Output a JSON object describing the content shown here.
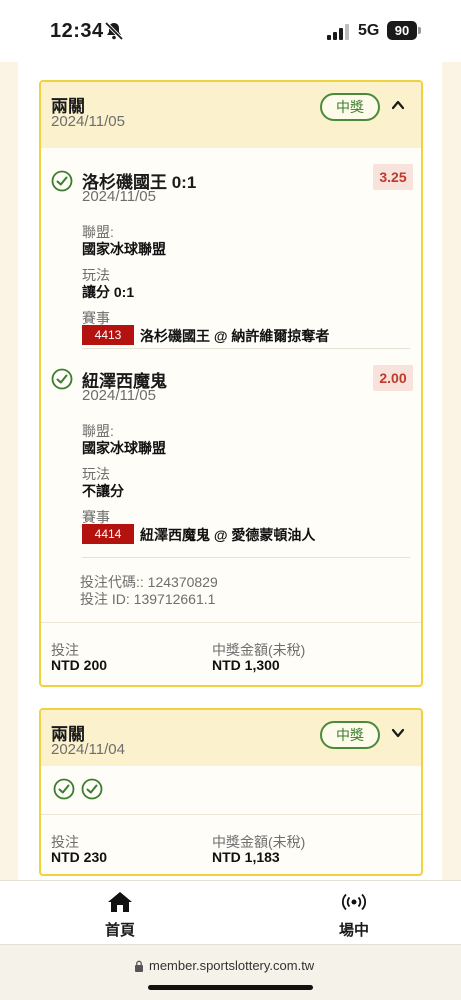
{
  "status_bar": {
    "time": "12:34",
    "network": "5G",
    "battery": "90"
  },
  "bets": [
    {
      "type": "兩關",
      "date": "2024/11/05",
      "status": "中獎",
      "expanded": true,
      "legs": [
        {
          "title": "洛杉磯國王 0:1",
          "date": "2024/11/05",
          "odds": "3.25",
          "league_label": "聯盟:",
          "league": "國家冰球聯盟",
          "market_label": "玩法",
          "market": "讓分 0:1",
          "event_label": "賽事",
          "event_id": "4413",
          "event_name": "洛杉磯國王 @ 納許維爾掠奪者"
        },
        {
          "title": "紐澤西魔鬼",
          "date": "2024/11/05",
          "odds": "2.00",
          "league_label": "聯盟:",
          "league": "國家冰球聯盟",
          "market_label": "玩法",
          "market": "不讓分",
          "event_label": "賽事",
          "event_id": "4414",
          "event_name": "紐澤西魔鬼 @ 愛德蒙頓油人"
        }
      ],
      "bet_code": "投注代碼:: 124370829",
      "bet_id": "投注 ID: 139712661.1",
      "stake_label": "投注",
      "stake": "NTD 200",
      "payout_label": "中獎金額(未稅)",
      "payout": "NTD 1,300"
    },
    {
      "type": "兩關",
      "date": "2024/11/04",
      "status": "中獎",
      "expanded": false,
      "stake_label": "投注",
      "stake": "NTD 230",
      "payout_label": "中獎金額(未稅)",
      "payout": "NTD 1,183"
    }
  ],
  "bottom_nav": {
    "home_label": "首頁",
    "home_icon": "home-icon",
    "live_label": "場中",
    "live_icon": "broadcast-icon"
  },
  "url_bar": {
    "url": "member.sportslottery.com.tw"
  },
  "colors": {
    "card_border": "#f0d23c",
    "header_bg": "#fbf1cd",
    "win_green": "#3b7d2e",
    "odds_red": "#c0392b",
    "event_badge": "#b3120f"
  }
}
